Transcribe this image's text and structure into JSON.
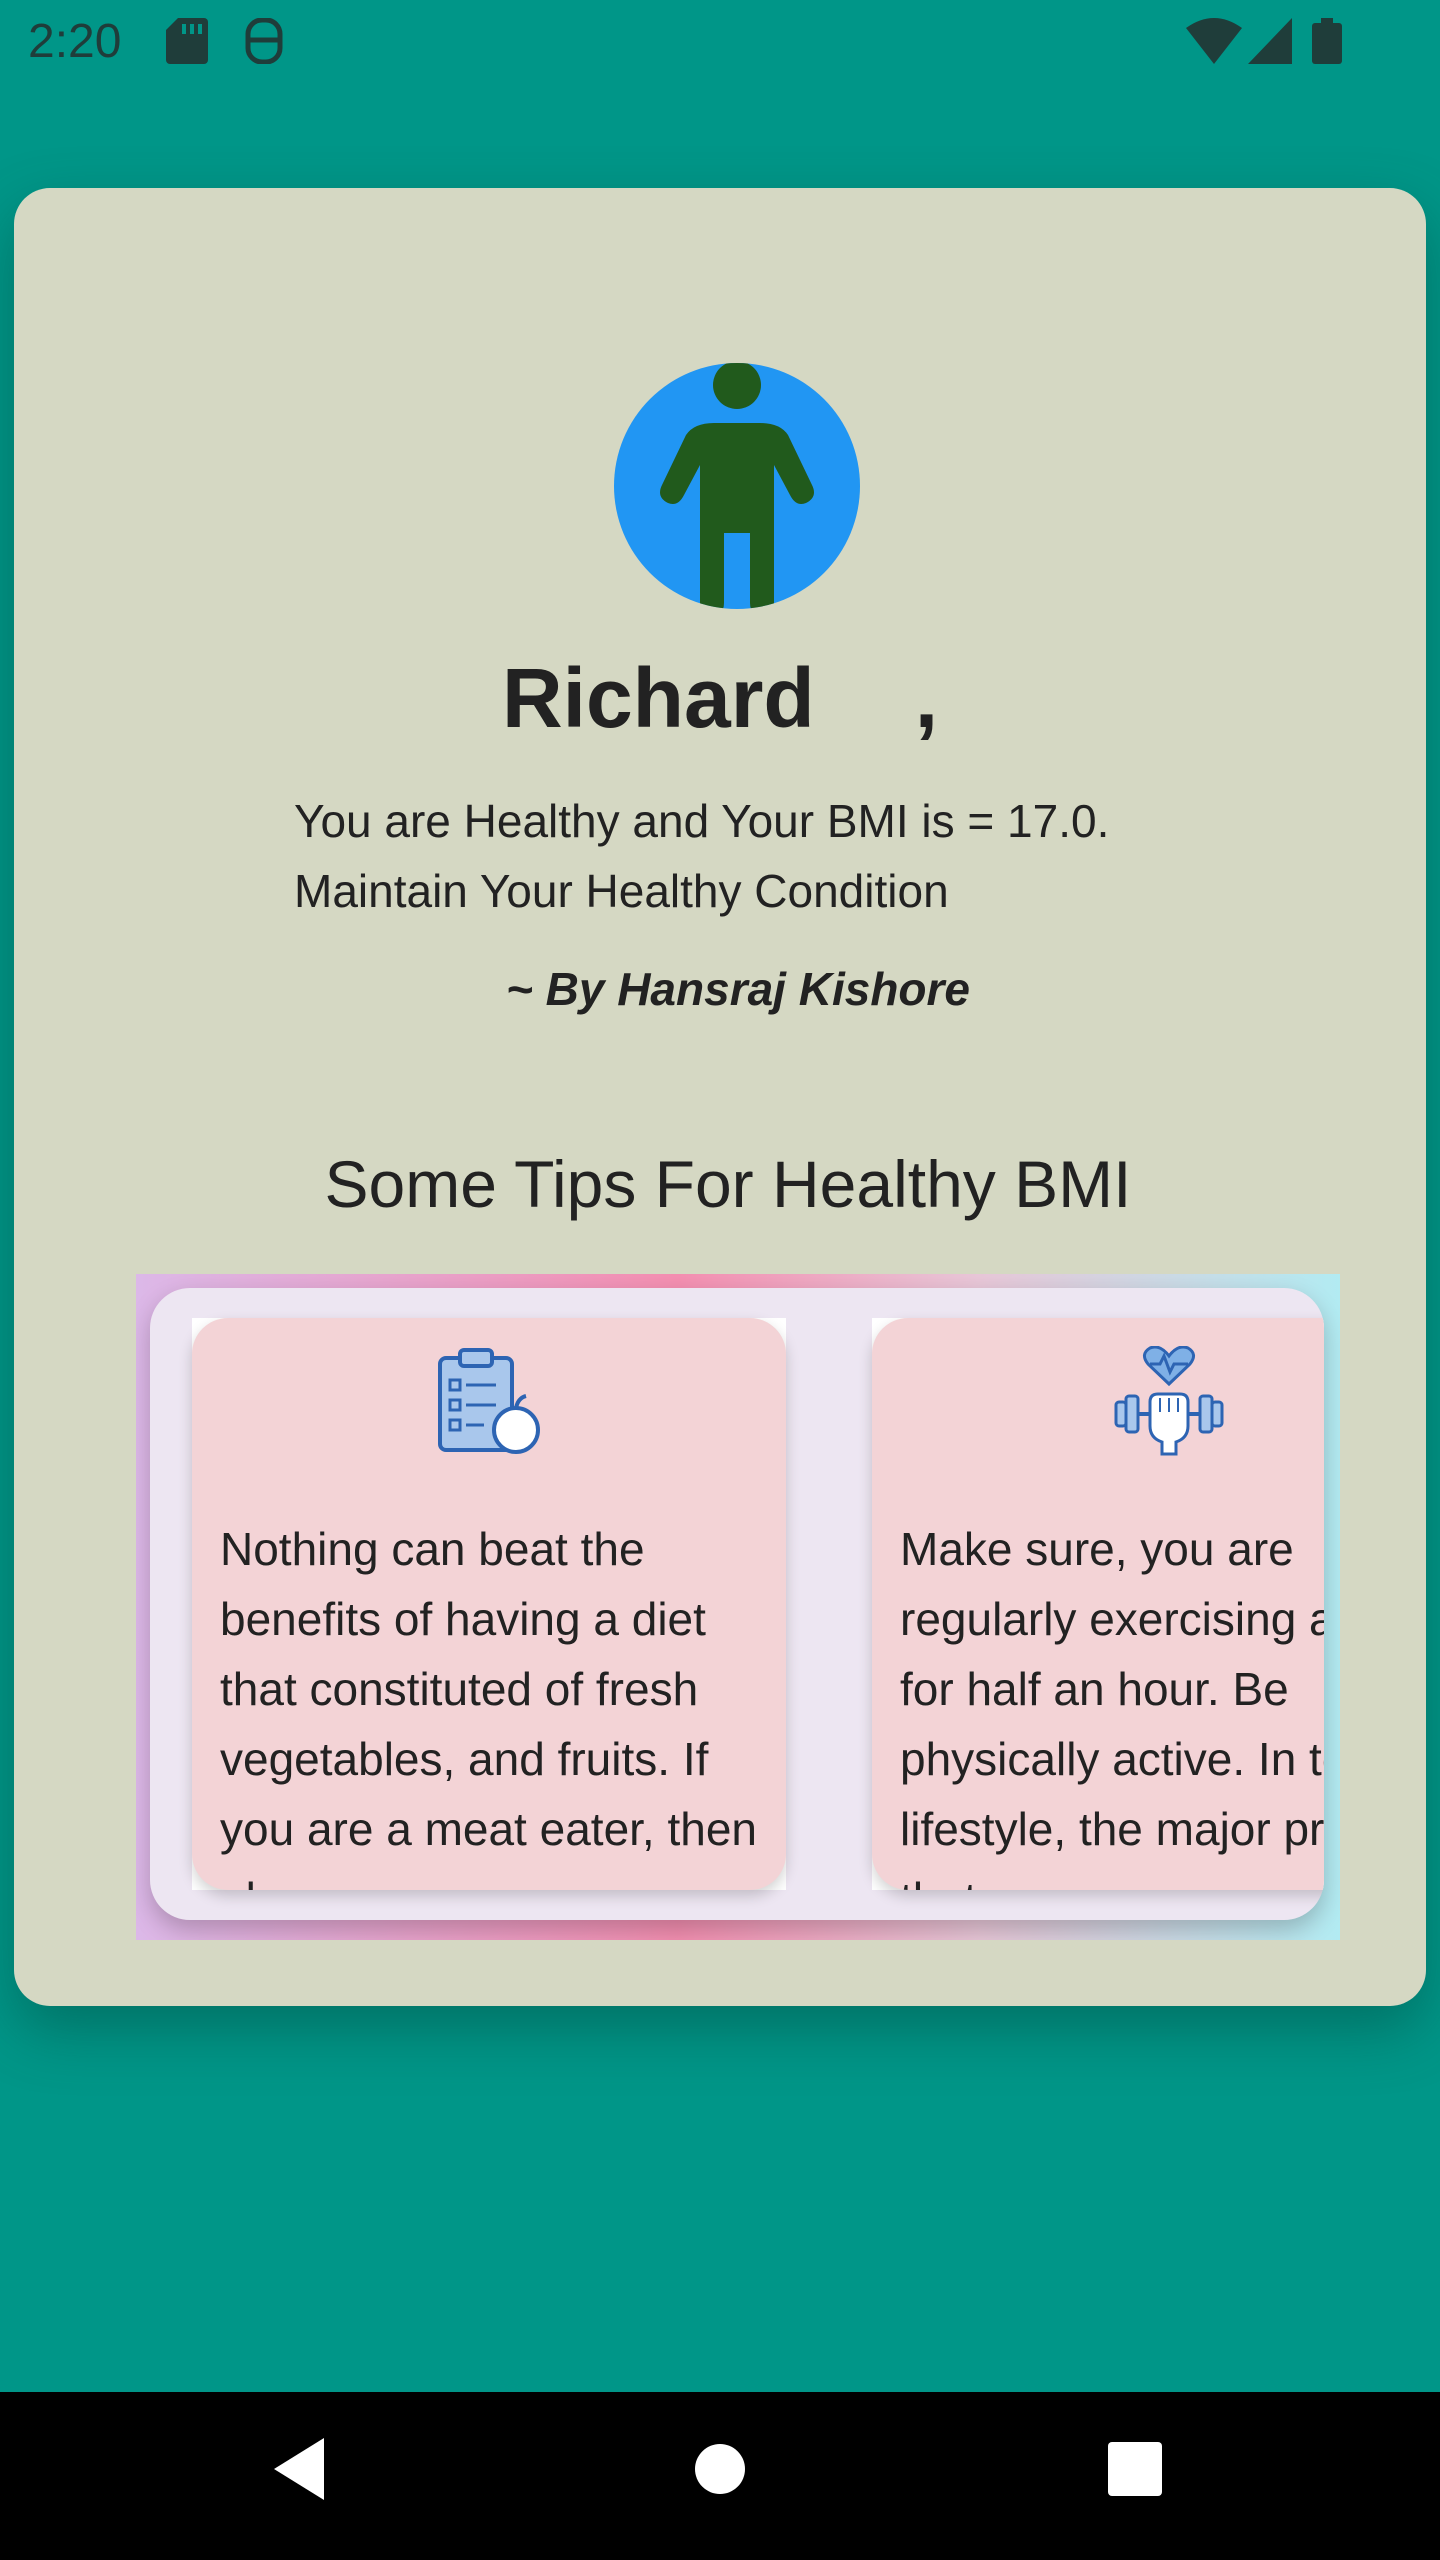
{
  "status_bar": {
    "time": "2:20",
    "icons": [
      "sd-card-icon",
      "accessibility-icon",
      "wifi-icon",
      "signal-icon",
      "battery-icon"
    ]
  },
  "profile": {
    "name": "Richard",
    "separator": ",",
    "message": "You are Healthy and Your BMI is = 17.0. Maintain Your Healthy Condition",
    "author": "~ By Hansraj Kishore"
  },
  "tips": {
    "heading": "Some Tips For Healthy BMI",
    "items": [
      {
        "icon": "diet-clipboard-apple-icon",
        "text": "Nothing can beat the benefits of having a diet that constituted of fresh vegetables, and fruits. If you are a meat eater, then always"
      },
      {
        "icon": "fitness-dumbbell-heart-icon",
        "text": "Make sure, you are regularly exercising at least for half an hour. Be physically active. In today’s lifestyle, the major problem that"
      }
    ]
  },
  "colors": {
    "background": "#009688",
    "card": "#d5d8c3",
    "avatar": "#2196f3",
    "figure": "#215a1c",
    "tip_card": "#f3d3d6"
  },
  "nav_bar": {
    "buttons": [
      "back-icon",
      "home-icon",
      "recents-icon"
    ]
  }
}
